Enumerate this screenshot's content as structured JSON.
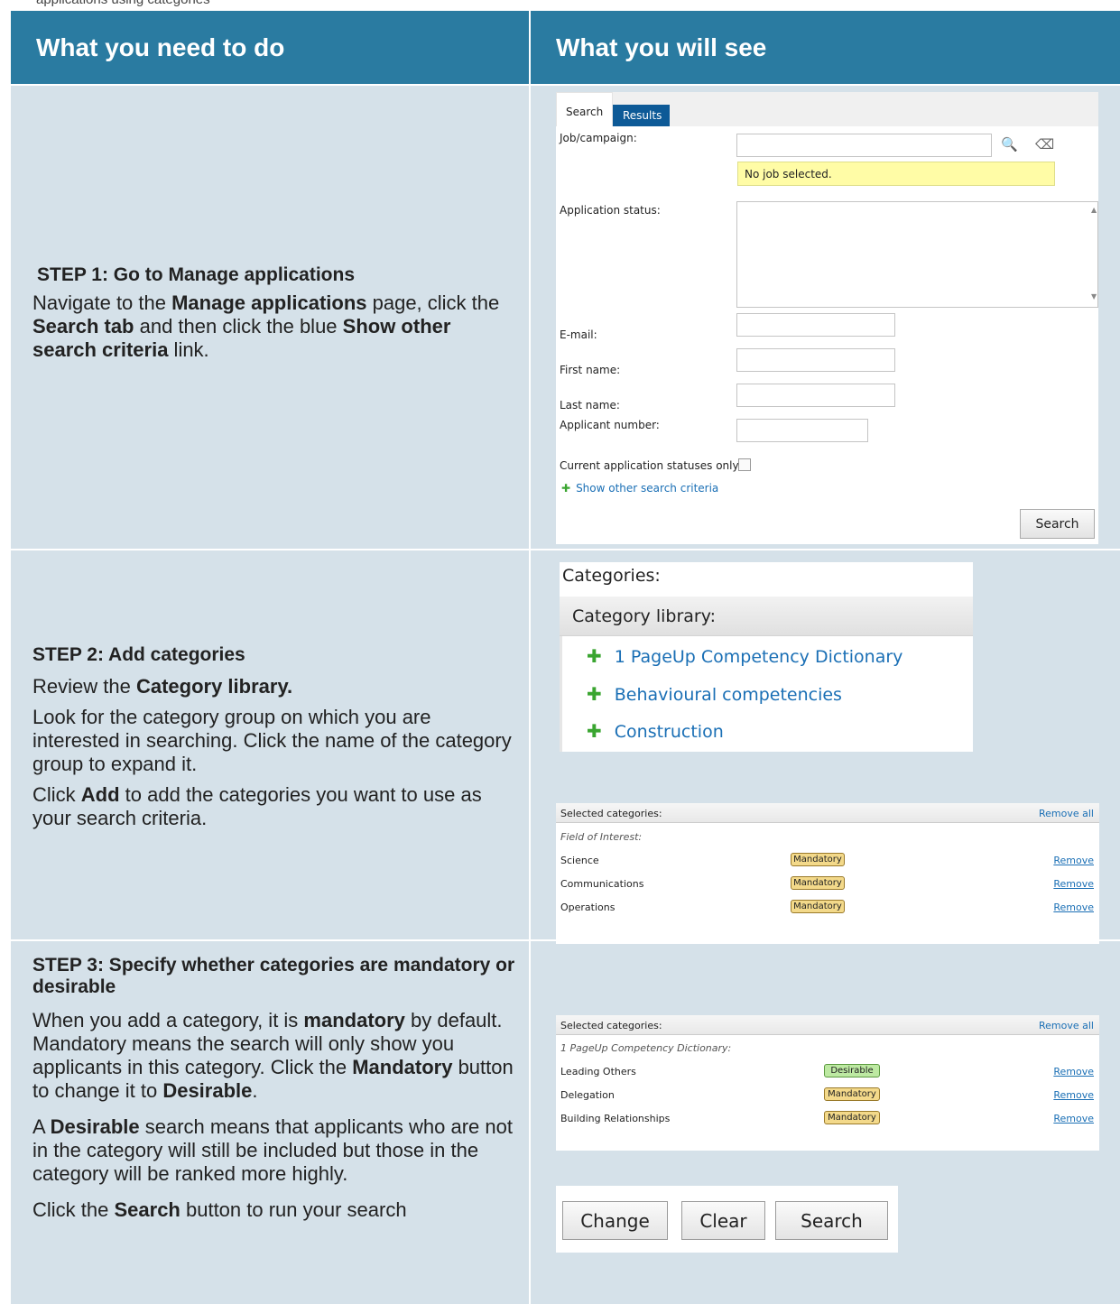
{
  "top_strip": {
    "text": "applications using categories"
  },
  "header": {
    "left": "What you need to do",
    "right": "What you will see"
  },
  "step1": {
    "title": "STEP 1: Go to Manage applications",
    "t1": "Navigate to the ",
    "b1": "Manage applications",
    "t2": " page, click the ",
    "b2": "Search tab",
    "t3": " and then click the blue ",
    "b3": "Show other search criteria",
    "t4": " link.",
    "screenshot": {
      "tab_search": "Search",
      "tab_results": "Results",
      "job_label": "Job/campaign:",
      "job_notice": "No job selected.",
      "status_label": "Application status:",
      "email_label": "E-mail:",
      "first_label": "First name:",
      "last_label": "Last name:",
      "applicant_label": "Applicant number:",
      "current_label": "Current application statuses only:",
      "show_other": "Show other search criteria",
      "search_button": "Search"
    }
  },
  "step2": {
    "title": "STEP 2: Add categories",
    "p1_t": "Review the ",
    "p1_b": "Category library.",
    "p2": "Look for the category group on which you are interested in searching. Click the name of the category group to expand it.",
    "p3_t1": "Click ",
    "p3_b": "Add",
    "p3_t2": " to add the categories you want to use as your search criteria.",
    "categories_title": "Categories:",
    "library_title": "Category library:",
    "library_items": [
      "1 PageUp Competency Dictionary",
      "Behavioural competencies",
      "Construction"
    ],
    "selected": {
      "title": "Selected categories:",
      "remove_all": "Remove all",
      "group": "Field of Interest:",
      "rows": [
        {
          "name": "Science",
          "button": "Mandatory",
          "remove": "Remove"
        },
        {
          "name": "Communications",
          "button": "Mandatory",
          "remove": "Remove"
        },
        {
          "name": "Operations",
          "button": "Mandatory",
          "remove": "Remove"
        }
      ]
    }
  },
  "step3": {
    "title": "STEP 3: Specify whether categories are mandatory or desirable",
    "p1_t1": "When you add a category, it is ",
    "p1_b1": "mandatory",
    "p1_t2": " by default. Mandatory means the search will only show you applicants in this category. Click the ",
    "p1_b2": "Mandatory",
    "p1_t3": " button to change it to ",
    "p1_b3": "Desirable",
    "p1_t4": ".",
    "p2_b": "Desirable",
    "p2_t": " search means that applicants who are not in the category will still be included but those in the category will be ranked more highly.",
    "p2_a": "A ",
    "p3_t1": "Click the ",
    "p3_b": "Search",
    "p3_t2": " button to run your search",
    "selected": {
      "title": "Selected categories:",
      "remove_all": "Remove all",
      "group": "1 PageUp Competency Dictionary:",
      "rows": [
        {
          "name": "Leading Others",
          "button": "Desirable",
          "remove": "Remove"
        },
        {
          "name": "Delegation",
          "button": "Mandatory",
          "remove": "Remove"
        },
        {
          "name": "Building Relationships",
          "button": "Mandatory",
          "remove": "Remove"
        }
      ]
    },
    "buttons": {
      "change": "Change",
      "clear": "Clear",
      "search": "Search"
    }
  },
  "colors": {
    "header_bg": "#2a7ba1",
    "cell_bg": "#d5e1e9",
    "link": "#1a6fb5",
    "mandatory": "#f3d98a",
    "desirable": "#bde9a2"
  }
}
